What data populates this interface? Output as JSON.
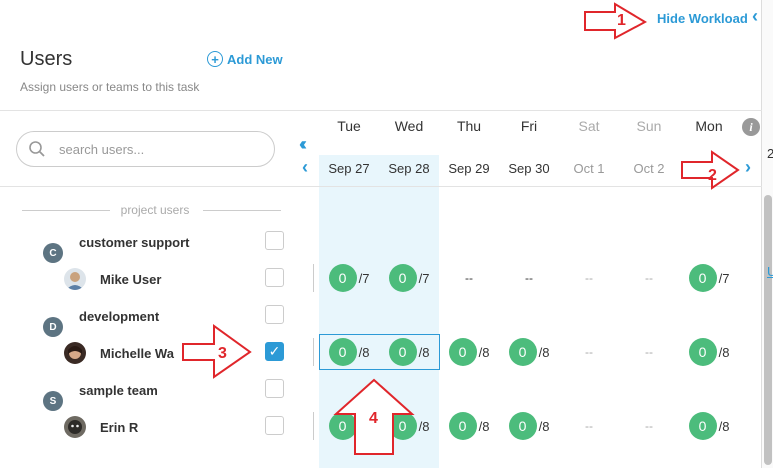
{
  "header": {
    "hide_workload_label": "Hide Workload",
    "title": "Users",
    "subtitle": "Assign users or teams to this task",
    "add_new_label": "Add New"
  },
  "search": {
    "placeholder": "search users..."
  },
  "calendar": {
    "days": [
      {
        "name": "Tue",
        "date": "Sep 27",
        "weekend": false
      },
      {
        "name": "Wed",
        "date": "Sep 28",
        "weekend": false
      },
      {
        "name": "Thu",
        "date": "Sep 29",
        "weekend": false
      },
      {
        "name": "Fri",
        "date": "Sep 30",
        "weekend": false
      },
      {
        "name": "Sat",
        "date": "Oct 1",
        "weekend": true
      },
      {
        "name": "Sun",
        "date": "Oct 2",
        "weekend": true
      },
      {
        "name": "Mon",
        "date": "",
        "weekend": false
      }
    ]
  },
  "section_label": "project users",
  "rows": [
    {
      "type": "team",
      "badge": "C",
      "label": "customer support",
      "checked": false
    },
    {
      "type": "user",
      "label": "Mike User",
      "checked": false,
      "cells": [
        [
          "0",
          "/7"
        ],
        [
          "0",
          "/7"
        ],
        [
          "--",
          ""
        ],
        [
          "--",
          ""
        ],
        [
          "--",
          ""
        ],
        [
          "--",
          ""
        ],
        [
          "0",
          "/7"
        ]
      ]
    },
    {
      "type": "team",
      "badge": "D",
      "label": "development",
      "checked": false
    },
    {
      "type": "user",
      "label": "Michelle Wa",
      "checked": true,
      "cells": [
        [
          "0",
          "/8"
        ],
        [
          "0",
          "/8"
        ],
        [
          "0",
          "/8"
        ],
        [
          "0",
          "/8"
        ],
        [
          "--",
          ""
        ],
        [
          "--",
          ""
        ],
        [
          "0",
          "/8"
        ]
      ]
    },
    {
      "type": "team",
      "badge": "S",
      "label": "sample team",
      "checked": false
    },
    {
      "type": "user",
      "label": "Erin R",
      "checked": false,
      "cells": [
        [
          "0",
          "/8"
        ],
        [
          "0",
          "/8"
        ],
        [
          "0",
          "/8"
        ],
        [
          "0",
          "/8"
        ],
        [
          "--",
          ""
        ],
        [
          "--",
          ""
        ],
        [
          "0",
          "/8"
        ]
      ]
    }
  ],
  "annotations": [
    "1",
    "2",
    "3",
    "4"
  ],
  "edge_fragments": [
    "2",
    "U"
  ],
  "colors": {
    "accent": "#2c9ad6",
    "available": "#4cbc7c",
    "annotation": "#e0262b"
  }
}
